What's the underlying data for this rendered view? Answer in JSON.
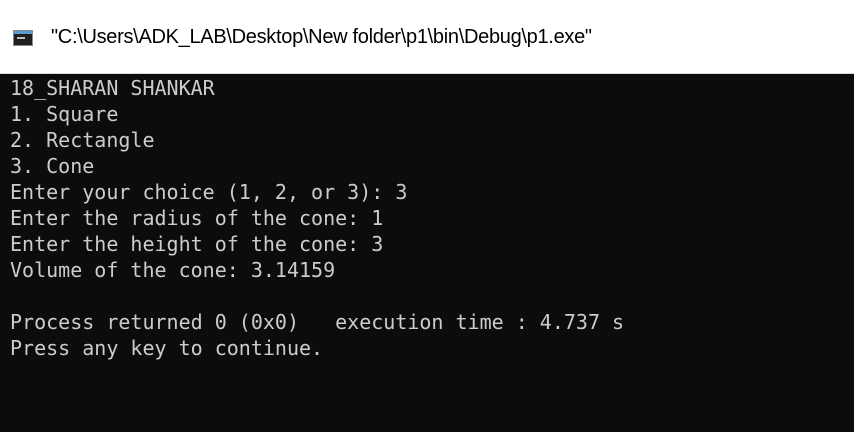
{
  "window": {
    "title": "\"C:\\Users\\ADK_LAB\\Desktop\\New folder\\p1\\bin\\Debug\\p1.exe\"",
    "icon": "console-window-icon"
  },
  "console": {
    "lines": [
      "18_SHARAN SHANKAR",
      "1. Square",
      "2. Rectangle",
      "3. Cone",
      "Enter your choice (1, 2, or 3): 3",
      "Enter the radius of the cone: 1",
      "Enter the height of the cone: 3",
      "Volume of the cone: 3.14159",
      "",
      "Process returned 0 (0x0)   execution time : 4.737 s",
      "Press any key to continue."
    ]
  },
  "colors": {
    "console_bg": "#0c0c0c",
    "console_text": "#cccccc",
    "titlebar_bg": "#ffffff"
  }
}
